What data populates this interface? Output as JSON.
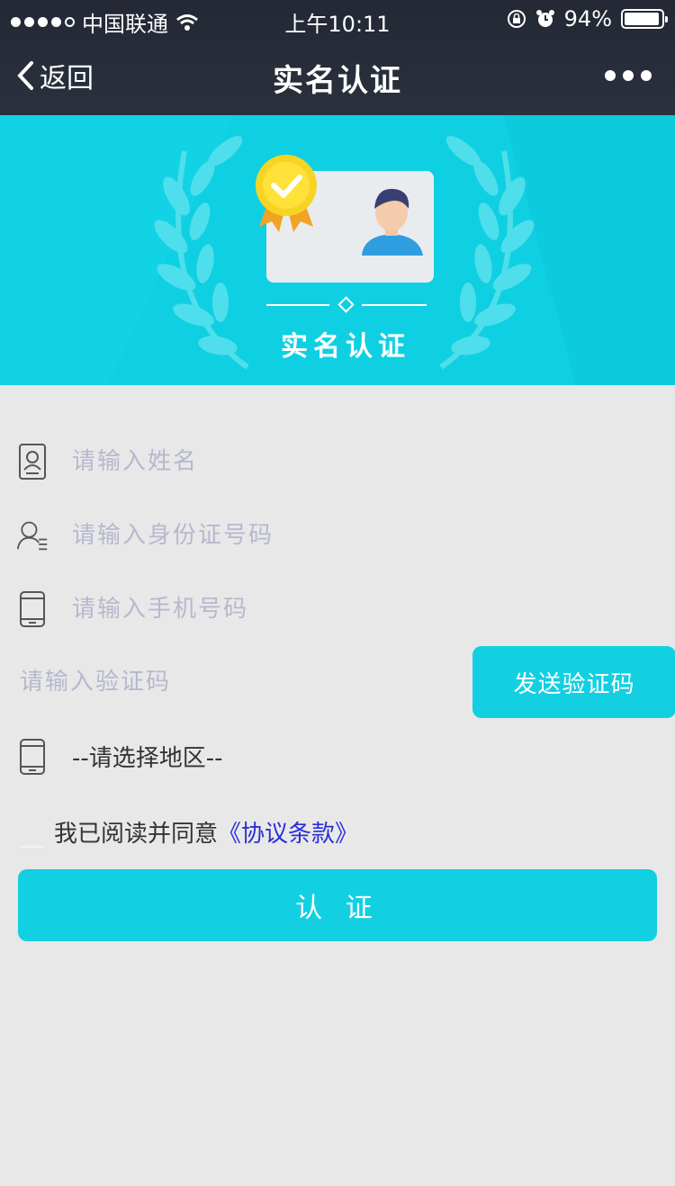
{
  "status": {
    "carrier": "中国联通",
    "time": "上午10:11",
    "battery": "94%",
    "battery_level": 0.94,
    "signal_bars": 4
  },
  "nav": {
    "back_label": "返回",
    "title": "实名认证",
    "more_icon": "ellipsis-icon"
  },
  "banner": {
    "title": "实名认证"
  },
  "form": {
    "name_placeholder": "请输入姓名",
    "id_placeholder": "请输入身份证号码",
    "phone_placeholder": "请输入手机号码",
    "code_placeholder": "请输入验证码",
    "send_code_label": "发送验证码",
    "region_label": "--请选择地区--",
    "agree_text": "我已阅读并同意",
    "agree_link": "《协议条款》",
    "submit_label": "认 证"
  },
  "colors": {
    "accent": "#12d0e2",
    "nav_bg": "#262c38",
    "page_bg": "#e8e8e8",
    "link": "#2b2fd4"
  }
}
